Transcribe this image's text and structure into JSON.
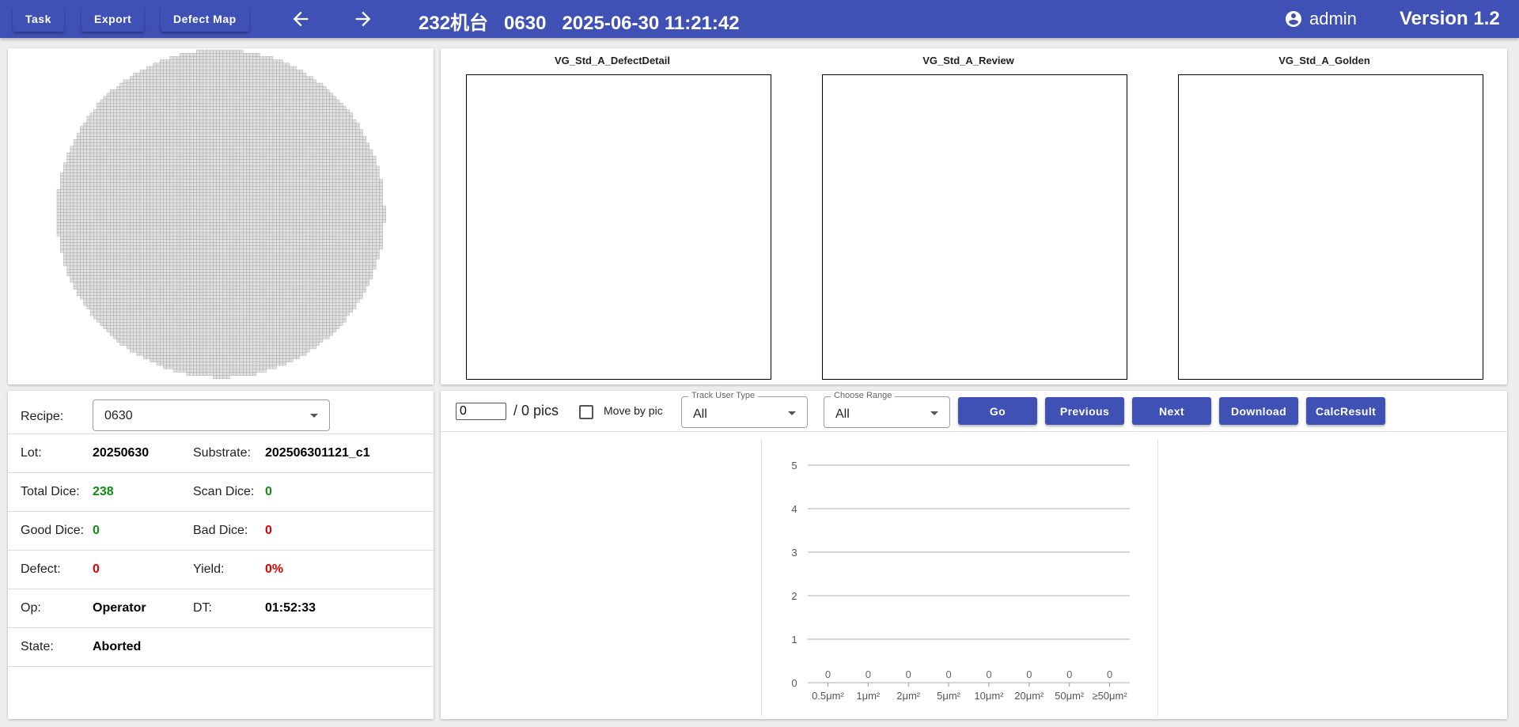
{
  "topbar": {
    "task_label": "Task",
    "export_label": "Export",
    "defect_map_label": "Defect Map",
    "title": "232机台   0630   2025-06-30 11:21:42",
    "user": "admin",
    "version": "Version 1.2"
  },
  "images": {
    "titles": [
      "VG_Std_A_DefectDetail",
      "VG_Std_A_Review",
      "VG_Std_A_Golden"
    ]
  },
  "info": {
    "recipe_label": "Recipe:",
    "recipe_value": "0630",
    "lot_label": "Lot:",
    "lot_value": "20250630",
    "substrate_label": "Substrate:",
    "substrate_value": "202506301121_c1",
    "total_dice_label": "Total Dice:",
    "total_dice_value": "238",
    "scan_dice_label": "Scan Dice:",
    "scan_dice_value": "0",
    "good_dice_label": "Good Dice:",
    "good_dice_value": "0",
    "bad_dice_label": "Bad Dice:",
    "bad_dice_value": "0",
    "defect_label": "Defect:",
    "defect_value": "0",
    "yield_label": "Yield:",
    "yield_value": "0%",
    "op_label": "Op:",
    "op_value": "Operator",
    "dt_label": "DT:",
    "dt_value": "01:52:33",
    "state_label": "State:",
    "state_value": "Aborted"
  },
  "controls": {
    "pic_index": "0",
    "pics_total": "/ 0 pics",
    "move_by_pic_label": "Move by pic",
    "move_by_pic_checked": false,
    "track_user_type_label": "Track User Type",
    "track_user_type_value": "All",
    "choose_range_label": "Choose Range",
    "choose_range_value": "All",
    "go_label": "Go",
    "previous_label": "Previous",
    "next_label": "Next",
    "download_label": "Download",
    "calc_result_label": "CalcResult"
  },
  "colors": {
    "primary": "#3f51b5",
    "good": "#138a13",
    "bad": "#e00000",
    "wafer_die": "#e0e0e0",
    "wafer_grid": "#9a9a9a"
  },
  "chart_data": {
    "type": "bar",
    "categories": [
      "0.5μm²",
      "1μm²",
      "2μm²",
      "5μm²",
      "10μm²",
      "20μm²",
      "50μm²",
      "≥50μm²"
    ],
    "values": [
      0,
      0,
      0,
      0,
      0,
      0,
      0,
      0
    ],
    "ylim": [
      0,
      5
    ],
    "yticks": [
      0,
      1,
      2,
      3,
      4,
      5
    ],
    "grid": true
  }
}
